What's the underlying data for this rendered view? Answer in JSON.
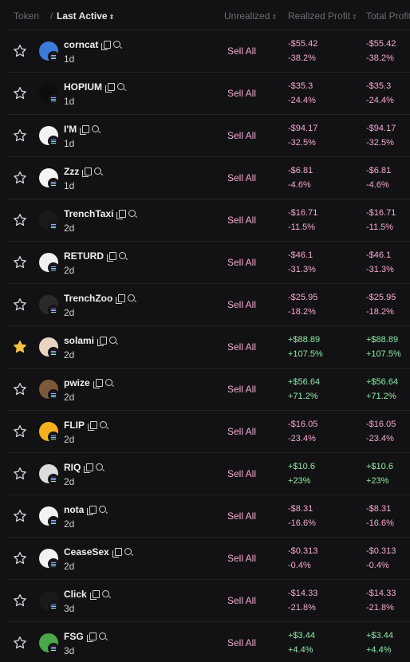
{
  "header": {
    "token": "Token",
    "separator": "/",
    "last_active": "Last Active",
    "unrealized": "Unrealized",
    "realized_profit": "Realized Profit",
    "total_profit": "Total Profit"
  },
  "colors": {
    "negative": "#f4a8d0",
    "positive": "#8ee6a6",
    "star_active": "#f5c242",
    "background": "#121214"
  },
  "sell_label": "Sell All",
  "rows": [
    {
      "name": "corncat",
      "age": "1d",
      "rp_amt": "-$55.42",
      "rp_pct": "-38.2%",
      "tp_amt": "-$55.42",
      "tp_pct": "-38.2%",
      "positive": false,
      "starred": false,
      "avatar_color": "#3b7bdc"
    },
    {
      "name": "HOPIUM",
      "age": "1d",
      "rp_amt": "-$35.3",
      "rp_pct": "-24.4%",
      "tp_amt": "-$35.3",
      "tp_pct": "-24.4%",
      "positive": false,
      "starred": false,
      "avatar_color": "#0d0d10"
    },
    {
      "name": "I'M",
      "age": "1d",
      "rp_amt": "-$94.17",
      "rp_pct": "-32.5%",
      "tp_amt": "-$94.17",
      "tp_pct": "-32.5%",
      "positive": false,
      "starred": false,
      "avatar_color": "#f2f2f2"
    },
    {
      "name": "Zzz",
      "age": "1d",
      "rp_amt": "-$6.81",
      "rp_pct": "-4.6%",
      "tp_amt": "-$6.81",
      "tp_pct": "-4.6%",
      "positive": false,
      "starred": false,
      "avatar_color": "#f5f5f5"
    },
    {
      "name": "TrenchTaxi",
      "age": "2d",
      "rp_amt": "-$16.71",
      "rp_pct": "-11.5%",
      "tp_amt": "-$16.71",
      "tp_pct": "-11.5%",
      "positive": false,
      "starred": false,
      "avatar_color": "#1a1a1a"
    },
    {
      "name": "RETURD",
      "age": "2d",
      "rp_amt": "-$46.1",
      "rp_pct": "-31.3%",
      "tp_amt": "-$46.1",
      "tp_pct": "-31.3%",
      "positive": false,
      "starred": false,
      "avatar_color": "#f0f0f0"
    },
    {
      "name": "TrenchZoo",
      "age": "2d",
      "rp_amt": "-$25.95",
      "rp_pct": "-18.2%",
      "tp_amt": "-$25.95",
      "tp_pct": "-18.2%",
      "positive": false,
      "starred": false,
      "avatar_color": "#2a2a2a"
    },
    {
      "name": "solami",
      "age": "2d",
      "rp_amt": "+$88.89",
      "rp_pct": "+107.5%",
      "tp_amt": "+$88.89",
      "tp_pct": "+107.5%",
      "positive": true,
      "starred": true,
      "avatar_color": "#e9d3c1"
    },
    {
      "name": "pwize",
      "age": "2d",
      "rp_amt": "+$56.64",
      "rp_pct": "+71.2%",
      "tp_amt": "+$56.64",
      "tp_pct": "+71.2%",
      "positive": true,
      "starred": false,
      "avatar_color": "#7a5a3a"
    },
    {
      "name": "FLIP",
      "age": "2d",
      "rp_amt": "-$16.05",
      "rp_pct": "-23.4%",
      "tp_amt": "-$16.05",
      "tp_pct": "-23.4%",
      "positive": false,
      "starred": false,
      "avatar_color": "#f5b21c"
    },
    {
      "name": "RIQ",
      "age": "2d",
      "rp_amt": "+$10.6",
      "rp_pct": "+23%",
      "tp_amt": "+$10.6",
      "tp_pct": "+23%",
      "positive": true,
      "starred": false,
      "avatar_color": "#dcdcdc"
    },
    {
      "name": "nota",
      "age": "2d",
      "rp_amt": "-$8.31",
      "rp_pct": "-16.6%",
      "tp_amt": "-$8.31",
      "tp_pct": "-16.6%",
      "positive": false,
      "starred": false,
      "avatar_color": "#f2f2f2"
    },
    {
      "name": "CeaseSex",
      "age": "2d",
      "rp_amt": "-$0.313",
      "rp_pct": "-0.4%",
      "tp_amt": "-$0.313",
      "tp_pct": "-0.4%",
      "positive": false,
      "starred": false,
      "avatar_color": "#f2f2f2"
    },
    {
      "name": "Click",
      "age": "3d",
      "rp_amt": "-$14.33",
      "rp_pct": "-21.8%",
      "tp_amt": "-$14.33",
      "tp_pct": "-21.8%",
      "positive": false,
      "starred": false,
      "avatar_color": "#1a1a1a"
    },
    {
      "name": "FSG",
      "age": "3d",
      "rp_amt": "+$3.44",
      "rp_pct": "+4.4%",
      "tp_amt": "+$3.44",
      "tp_pct": "+4.4%",
      "positive": true,
      "starred": false,
      "avatar_color": "#4aa84a"
    }
  ]
}
